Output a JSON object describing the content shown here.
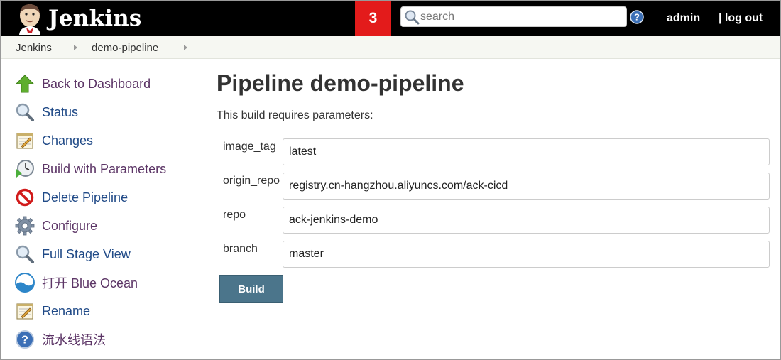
{
  "header": {
    "brand": "Jenkins",
    "logo_icon": "jenkins-butler-logo",
    "notification_count": "3",
    "search_placeholder": "search",
    "help_icon": "help-icon",
    "user": "admin",
    "logout": "| log out"
  },
  "breadcrumb": {
    "items": [
      "Jenkins",
      "demo-pipeline"
    ]
  },
  "sidebar": {
    "items": [
      {
        "label": "Back to Dashboard",
        "icon": "up-arrow-icon"
      },
      {
        "label": "Status",
        "icon": "magnifier-icon"
      },
      {
        "label": "Changes",
        "icon": "notepad-icon"
      },
      {
        "label": "Build with Parameters",
        "icon": "clock-icon"
      },
      {
        "label": "Delete Pipeline",
        "icon": "no-entry-icon"
      },
      {
        "label": "Configure",
        "icon": "gear-icon"
      },
      {
        "label": "Full Stage View",
        "icon": "magnifier-icon"
      },
      {
        "label": "打开 Blue Ocean",
        "icon": "blue-ocean-icon"
      },
      {
        "label": "Rename",
        "icon": "notepad-icon"
      },
      {
        "label": "流水线语法",
        "icon": "help-icon"
      }
    ]
  },
  "main": {
    "title": "Pipeline demo-pipeline",
    "description": "This build requires parameters:",
    "parameters": [
      {
        "name": "image_tag",
        "value": "latest"
      },
      {
        "name": "origin_repo",
        "value": "registry.cn-hangzhou.aliyuncs.com/ack-cicd"
      },
      {
        "name": "repo",
        "value": "ack-jenkins-demo"
      },
      {
        "name": "branch",
        "value": "master"
      }
    ],
    "build_label": "Build"
  },
  "colors": {
    "header_bg": "#000000",
    "notification_bg": "#e31b1b",
    "link": "#204a87",
    "build_button": "#4b758b"
  }
}
